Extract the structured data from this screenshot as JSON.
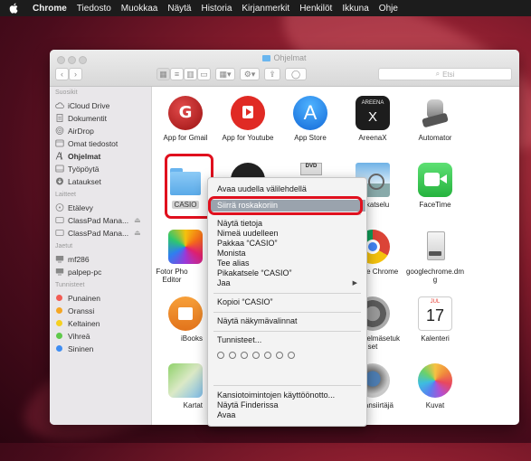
{
  "menubar": {
    "apple_icon": "apple-icon",
    "items": [
      "Chrome",
      "Tiedosto",
      "Muokkaa",
      "Näytä",
      "Historia",
      "Kirjanmerkit",
      "Henkilöt",
      "Ikkuna",
      "Ohje"
    ]
  },
  "window": {
    "title": "Ohjelmat",
    "search_placeholder": "Etsi"
  },
  "sidebar": {
    "favorites_header": "Suosikit",
    "favorites": [
      "iCloud Drive",
      "Dokumentit",
      "AirDrop",
      "Omat tiedostot",
      "Ohjelmat",
      "Työpöytä",
      "Lataukset"
    ],
    "devices_header": "Laitteet",
    "devices": [
      "Etälevy",
      "ClassPad Mana...",
      "ClassPad Mana..."
    ],
    "shared_header": "Jaetut",
    "shared": [
      "mf286",
      "palpep-pc"
    ],
    "tags_header": "Tunnisteet",
    "tags": [
      "Punainen",
      "Oranssi",
      "Keltainen",
      "Vihreä",
      "Sininen"
    ],
    "tag_colors": [
      "#f25c54",
      "#f5a623",
      "#f5d020",
      "#5fc94b",
      "#3f8df2"
    ]
  },
  "apps": {
    "row1": [
      "App for Gmail",
      "App for Youtube",
      "App Store",
      "AreenaX",
      "Automator"
    ],
    "areena_text": "AREENA",
    "areena_x": "X",
    "casio": "CASIO",
    "preview": "Esikatselu",
    "facetime": "FaceTime",
    "fotor": "Fotor Pho Editor",
    "chrome": "Google Chrome",
    "chromedmg": "googlechrome.dm g",
    "ibooks": "iBooks",
    "sysinfo": "Järjestelmäsetuk set",
    "calendar": "Kalenteri",
    "calendar_month": "JUL",
    "calendar_day": "17",
    "kartat": "Kartat",
    "imagecapture": "Kuvansiirtäjä",
    "photos": "Kuvat"
  },
  "context_menu": {
    "items": [
      "Avaa uudella välilehdellä",
      "Siirrä roskakoriin",
      "Näytä tietoja",
      "Nimeä uudelleen",
      "Pakkaa “CASIO”",
      "Monista",
      "Tee alias",
      "Pikakatsele “CASIO”",
      "Jaa",
      "Kopioi “CASIO”",
      "Näytä näkymävalinnat",
      "Tunnisteet...",
      "Kansiotoimintojen käyttöönotto...",
      "Näytä Finderissa",
      "Avaa"
    ],
    "submenu_arrow": "▶"
  },
  "colors": {
    "highlight_box": "#e0101e",
    "menu_highlight": "#9aa3ad"
  }
}
